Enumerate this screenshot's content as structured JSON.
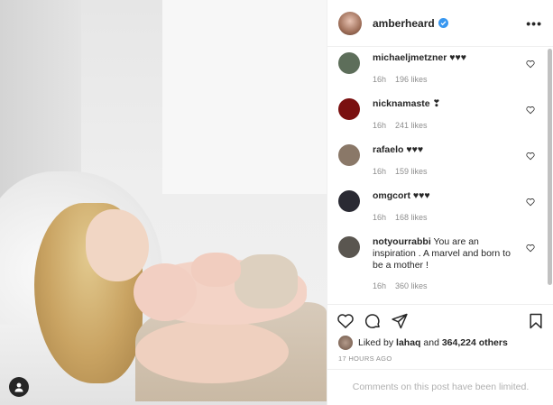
{
  "post": {
    "author": "amberheard",
    "colors": {
      "accent": "#3897f0",
      "text": "#262626",
      "muted": "#8e8e8e",
      "border": "#efefef"
    }
  },
  "comments": [
    {
      "user": "michaeljmetzner",
      "text": "♥♥♥",
      "time": "16h",
      "likes": "196 likes",
      "avatar_color": "#5d6e5a"
    },
    {
      "user": "nicknamaste",
      "text": "❣",
      "time": "16h",
      "likes": "241 likes",
      "avatar_color": "#7a1010"
    },
    {
      "user": "rafaelo",
      "text": "♥♥♥",
      "time": "16h",
      "likes": "159 likes",
      "avatar_color": "#8a7868"
    },
    {
      "user": "omgcort",
      "text": "♥♥♥",
      "time": "16h",
      "likes": "168 likes",
      "avatar_color": "#2a2a33"
    },
    {
      "user": "notyourrabbi",
      "text": "You are an inspiration . A marvel and born to be a mother !",
      "time": "16h",
      "likes": "360 likes",
      "avatar_color": "#5a5650"
    }
  ],
  "footer": {
    "liked_prefix": "Liked by",
    "liked_user": "lahaq",
    "liked_and": "and",
    "liked_others": "364,224 others",
    "timestamp": "17 HOURS AGO",
    "comments_disabled": "Comments on this post have been limited."
  },
  "icons": [
    "user-tag-icon",
    "verified-badge-icon",
    "more-options-icon",
    "heart-icon",
    "comment-icon",
    "share-icon",
    "bookmark-icon"
  ]
}
